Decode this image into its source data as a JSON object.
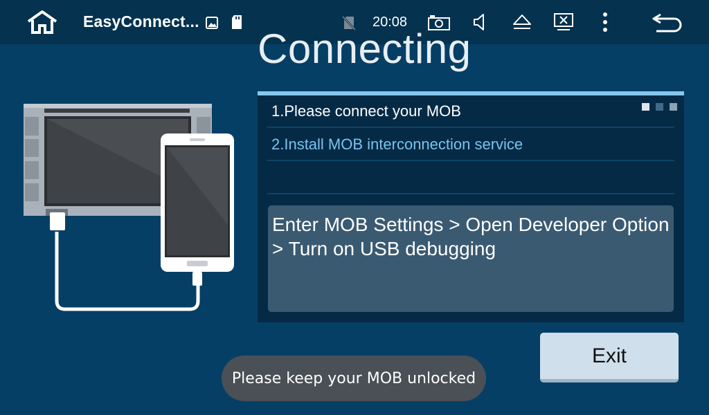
{
  "status_bar": {
    "app_title": "EasyConnect...",
    "time": "20:08",
    "icons": [
      "home-icon",
      "image-icon",
      "sd-card-icon",
      "no-sim-icon",
      "camera-icon",
      "volume-icon",
      "eject-icon",
      "close-window-icon",
      "more-vert-icon",
      "back-icon"
    ]
  },
  "heading": "Connecting",
  "steps": [
    {
      "label": "1.Please connect your MOB"
    },
    {
      "label": "2.Install MOB interconnection service"
    }
  ],
  "page_indicator": {
    "total": 3,
    "active": 1
  },
  "instruction": "Enter MOB Settings > Open Developer Option > Turn on USB debugging",
  "exit_button": {
    "label": "Exit"
  },
  "toast": "Please keep your MOB unlocked",
  "colors": {
    "background": "#063f65",
    "status_bar": "#04324f",
    "panel": "#052a45",
    "accent": "#86c7ee",
    "active_step": "#7ac3ee",
    "button": "#cfdfec",
    "toast": "#4a5055"
  }
}
